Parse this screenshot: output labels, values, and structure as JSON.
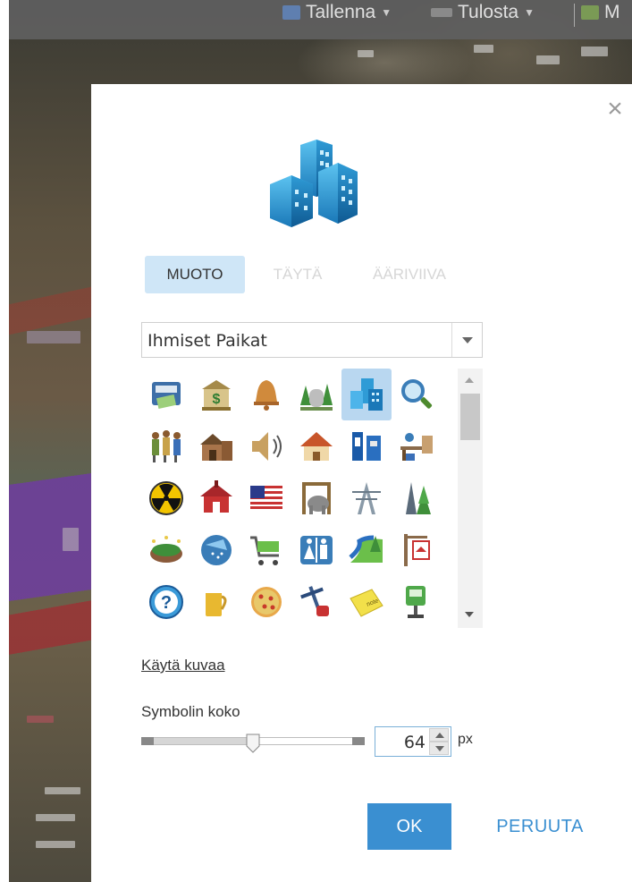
{
  "toolbar": {
    "items": [
      {
        "label": "Tallenna",
        "icon": "save-icon"
      },
      {
        "label": "Tulosta",
        "icon": "print-icon"
      },
      {
        "label": "M",
        "icon": "map-icon"
      }
    ]
  },
  "dialog": {
    "close_icon": "close-icon",
    "preview_icon": "buildings-icon",
    "tabs": [
      {
        "label": "MUOTO",
        "active": true
      },
      {
        "label": "TÄYTÄ",
        "active": false
      },
      {
        "label": "ÄÄRIVIIVA",
        "active": false
      }
    ],
    "category_select": {
      "value": "Ihmiset Paikat"
    },
    "symbols": [
      [
        "atm-icon",
        "bank-icon",
        "bell-icon",
        "cemetery-icon",
        "buildings-icon",
        "magnifier-icon"
      ],
      [
        "people-icon",
        "barn-icon",
        "speaker-icon",
        "house-icon",
        "mailbox-icon",
        "office-desk-icon"
      ],
      [
        "radiation-icon",
        "school-house-icon",
        "us-flag-icon",
        "zoo-icon",
        "power-tower-icon",
        "tree-tower-icon"
      ],
      [
        "stadium-icon",
        "shower-icon",
        "shopping-cart-icon",
        "restroom-icon",
        "river-park-icon",
        "for-sale-sign-icon"
      ],
      [
        "help-icon",
        "beer-icon",
        "pizza-icon",
        "oil-pump-icon",
        "note-icon",
        "parking-meter-icon"
      ]
    ],
    "selected_symbol": "buildings-icon",
    "use_image_link": "Käytä kuvaa",
    "size_label": "Symbolin koko",
    "size_value": "64",
    "size_fraction": 0.5,
    "size_unit": "px",
    "ok_label": "OK",
    "cancel_label": "PERUUTA"
  },
  "colors": {
    "accent": "#3a8fd1",
    "active_tab": "#cfe6f7",
    "selected_cell": "#b9d7f0"
  }
}
